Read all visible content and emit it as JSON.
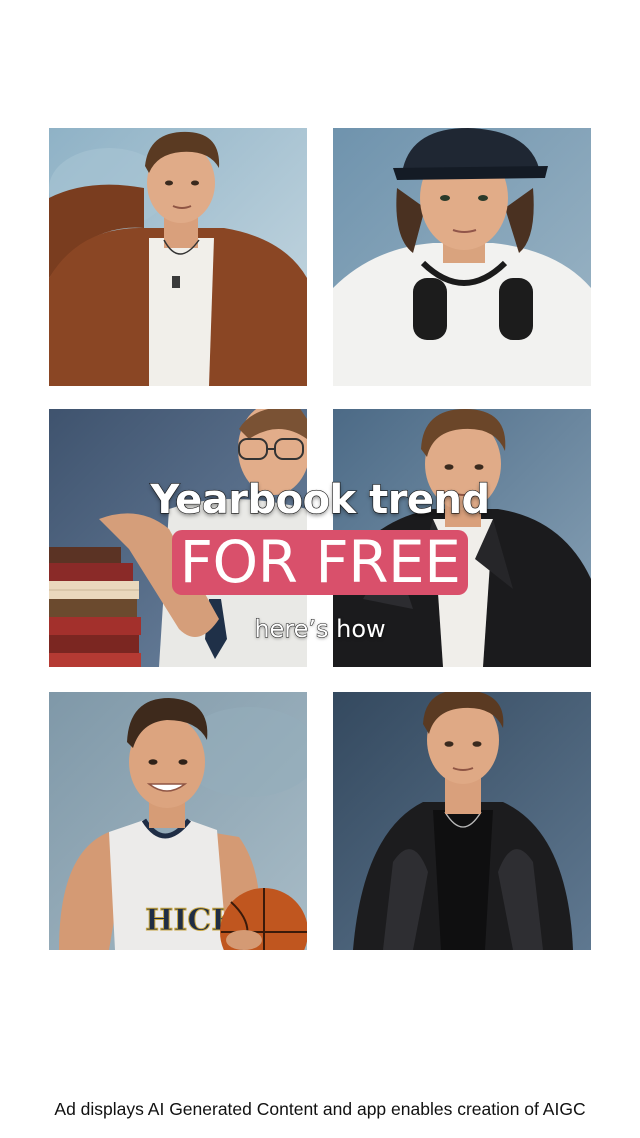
{
  "overlay": {
    "headline": "Yearbook trend",
    "badge": "FOR FREE",
    "subline": "here’s how"
  },
  "photos": [
    {
      "subject": "man in brown suede jacket with white tee"
    },
    {
      "subject": "man in black cap with headphones and white tee"
    },
    {
      "subject": "man with glasses holding stack of books"
    },
    {
      "subject": "man in black leather biker jacket"
    },
    {
      "subject": "smiling man in basketball jersey holding ball"
    },
    {
      "subject": "man in black leather jacket"
    }
  ],
  "photo_jersey_text": "HICK",
  "footer": {
    "disclaimer": "Ad displays AI Generated Content and app enables creation of AIGC"
  },
  "colors": {
    "background": "#ffffff",
    "badge": "#d9506b",
    "text": "#111111"
  }
}
